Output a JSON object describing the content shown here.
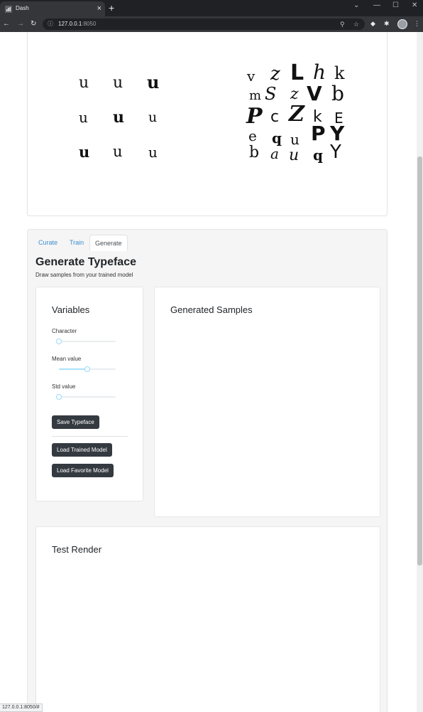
{
  "browser": {
    "tab_title": "Dash",
    "tab_close": "×",
    "new_tab": "+",
    "url_host": "127.0.0.1",
    "url_port": ":8050",
    "icons": [
      "back-icon",
      "forward-icon",
      "reload-icon",
      "info-icon",
      "zoom-icon",
      "star-icon",
      "extension-icon",
      "puzzle-icon",
      "profile-icon",
      "menu-icon"
    ]
  },
  "sample_grid": {
    "left": [
      "u",
      "u",
      "u",
      "u",
      "u",
      "u",
      "u",
      "u",
      "u"
    ],
    "right": [
      [
        "v",
        "z",
        "L",
        "h",
        "k"
      ],
      [
        "m",
        "S",
        "z",
        "V",
        "b"
      ],
      [
        "P",
        "c",
        "Z",
        "k",
        "E"
      ],
      [
        "e",
        "q",
        "u",
        "P",
        "Y"
      ],
      [
        "b",
        "a",
        "u",
        "q",
        "Y"
      ]
    ]
  },
  "tabs": [
    {
      "label": "Curate"
    },
    {
      "label": "Train"
    },
    {
      "label": "Generate"
    }
  ],
  "generate": {
    "title": "Generate Typeface",
    "subtitle": "Draw samples from your trained model"
  },
  "variables": {
    "title": "Variables",
    "character_label": "Character",
    "character_value": 0,
    "mean_label": "Mean value",
    "mean_value": 0.5,
    "std_label": "Std value",
    "std_value": 0,
    "save_button": "Save Typeface",
    "load_trained_button": "Load Trained Model",
    "load_favorite_button": "Load Favorite Model"
  },
  "generated": {
    "title": "Generated Samples"
  },
  "test_render": {
    "title": "Test Render"
  },
  "status_url": "127.0.0.1:8050/#",
  "colors": {
    "link": "#3c8dd0",
    "button": "#343a40",
    "slider": "#96dbfa"
  }
}
